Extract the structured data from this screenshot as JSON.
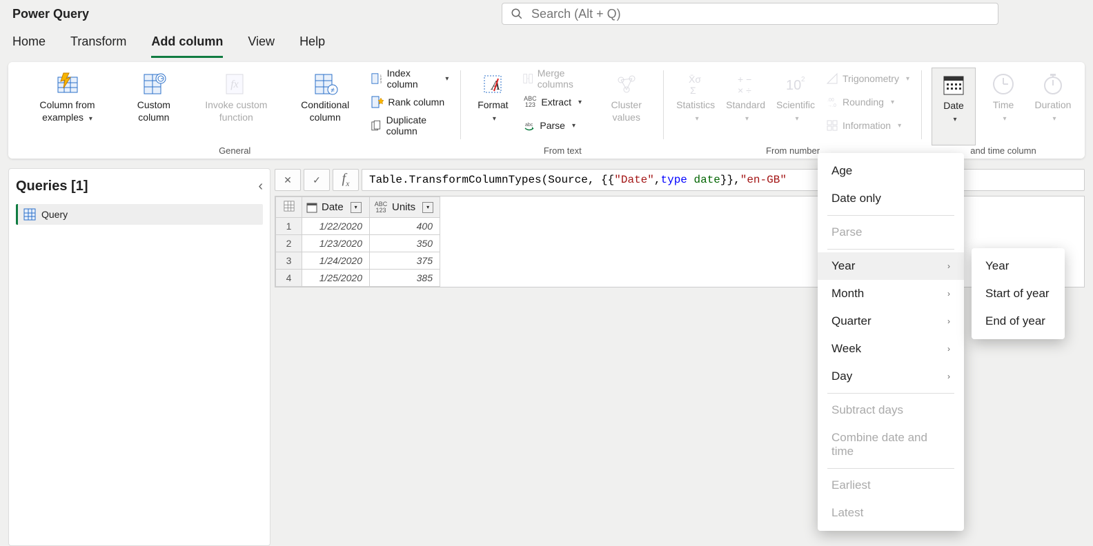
{
  "app_title": "Power Query",
  "search_placeholder": "Search (Alt + Q)",
  "tabs": [
    "Home",
    "Transform",
    "Add column",
    "View",
    "Help"
  ],
  "ribbon": {
    "general": {
      "label": "General",
      "col_examples": "Column from examples",
      "custom_col": "Custom column",
      "invoke_fn": "Invoke custom function",
      "cond_col": "Conditional column",
      "index_col": "Index column",
      "rank_col": "Rank column",
      "dup_col": "Duplicate column"
    },
    "from_text": {
      "label": "From text",
      "format": "Format",
      "merge": "Merge columns",
      "extract": "Extract",
      "parse": "Parse",
      "cluster": "Cluster values"
    },
    "from_number": {
      "label": "From number",
      "stats": "Statistics",
      "standard": "Standard",
      "scientific": "Scientific",
      "trig": "Trigonometry",
      "rounding": "Rounding",
      "info": "Information"
    },
    "date_time": {
      "label": "and time column",
      "date": "Date",
      "time": "Time",
      "duration": "Duration"
    }
  },
  "queries_title": "Queries [1]",
  "query_item": "Query",
  "formula_prefix": "Table.TransformColumnTypes(Source, {{",
  "formula_str": "\"Date\"",
  "formula_mid": ", ",
  "formula_type1": "type",
  "formula_type2": "date",
  "formula_suffix1": "}}, ",
  "formula_str2": "\"en-GB\"",
  "grid": {
    "col1": "Date",
    "col2": "Units",
    "abc": "ABC",
    "num": "123",
    "rows": [
      {
        "n": "1",
        "date": "1/22/2020",
        "units": "400"
      },
      {
        "n": "2",
        "date": "1/23/2020",
        "units": "350"
      },
      {
        "n": "3",
        "date": "1/24/2020",
        "units": "375"
      },
      {
        "n": "4",
        "date": "1/25/2020",
        "units": "385"
      }
    ]
  },
  "menu1": {
    "age": "Age",
    "date_only": "Date only",
    "parse": "Parse",
    "year": "Year",
    "month": "Month",
    "quarter": "Quarter",
    "week": "Week",
    "day": "Day",
    "subtract": "Subtract days",
    "combine": "Combine date and time",
    "earliest": "Earliest",
    "latest": "Latest"
  },
  "menu2": {
    "year": "Year",
    "start": "Start of year",
    "end": "End of year"
  }
}
